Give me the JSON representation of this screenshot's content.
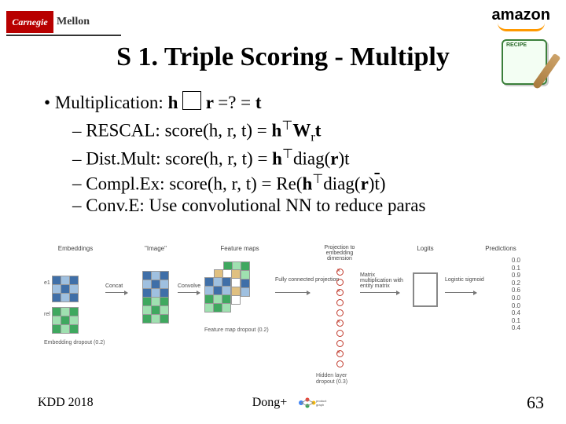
{
  "header": {
    "cmu_red": "Carnegie",
    "cmu_text": "Mellon",
    "amazon": "amazon"
  },
  "title": "S 1. Triple Scoring - Multiply",
  "bullet": {
    "lead": "Multiplication: ",
    "h": "h ",
    "r": " r ",
    "eq": "=? = ",
    "t": "t"
  },
  "subs": {
    "rescal": {
      "name": "RESCAL: ",
      "fn": "score(h, r, t) = ",
      "rhs1": "h",
      "rhs2": "W",
      "rhs2sub": "r",
      "rhs3": "t"
    },
    "distmult": {
      "name": "Dist.Mult: ",
      "fn": "score(h, r, t) = ",
      "rhs1": "h",
      "rhs2": "diag(",
      "rhs2r": "r",
      "rhs3": ")t"
    },
    "complex": {
      "name": "Compl.Ex: ",
      "fn": "score(h, r, t) = Re(",
      "rhs1": "h",
      "rhs2": "diag(",
      "rhs2r": "r",
      "rhs3": ")",
      "rhs4": "t",
      "rhs5": ")"
    },
    "conve": {
      "name": "Conv.E: ",
      "desc": "Use convolutional NN to reduce paras"
    }
  },
  "diagram": {
    "labels": {
      "embeddings": "Embeddings",
      "image": "\"Image\"",
      "featmaps": "Feature maps",
      "proj": "Projection to embedding dimension",
      "logits": "Logits",
      "preds": "Predictions"
    },
    "arrows": {
      "concat": "Concat",
      "convolve": "Convolve",
      "fc": "Fully connected projection",
      "matmul": "Matrix multiplication with entity matrix",
      "sigmoid": "Logistic sigmoid"
    },
    "captions": {
      "emb_drop": "Embedding dropout (0.2)",
      "feat_drop": "Feature map dropout (0.2)",
      "hid_drop": "Hidden layer dropout (0.3)"
    },
    "rowlabels": {
      "e1": "e1",
      "rel": "rel"
    },
    "pred_values": [
      "0.0",
      "0.1",
      "0.9",
      "0.2",
      "0.6",
      "0.0",
      "0.0",
      "0.4",
      "0.1",
      "0.4"
    ]
  },
  "footer": {
    "left": "KDD 2018",
    "center": "Dong+",
    "page": "63"
  }
}
